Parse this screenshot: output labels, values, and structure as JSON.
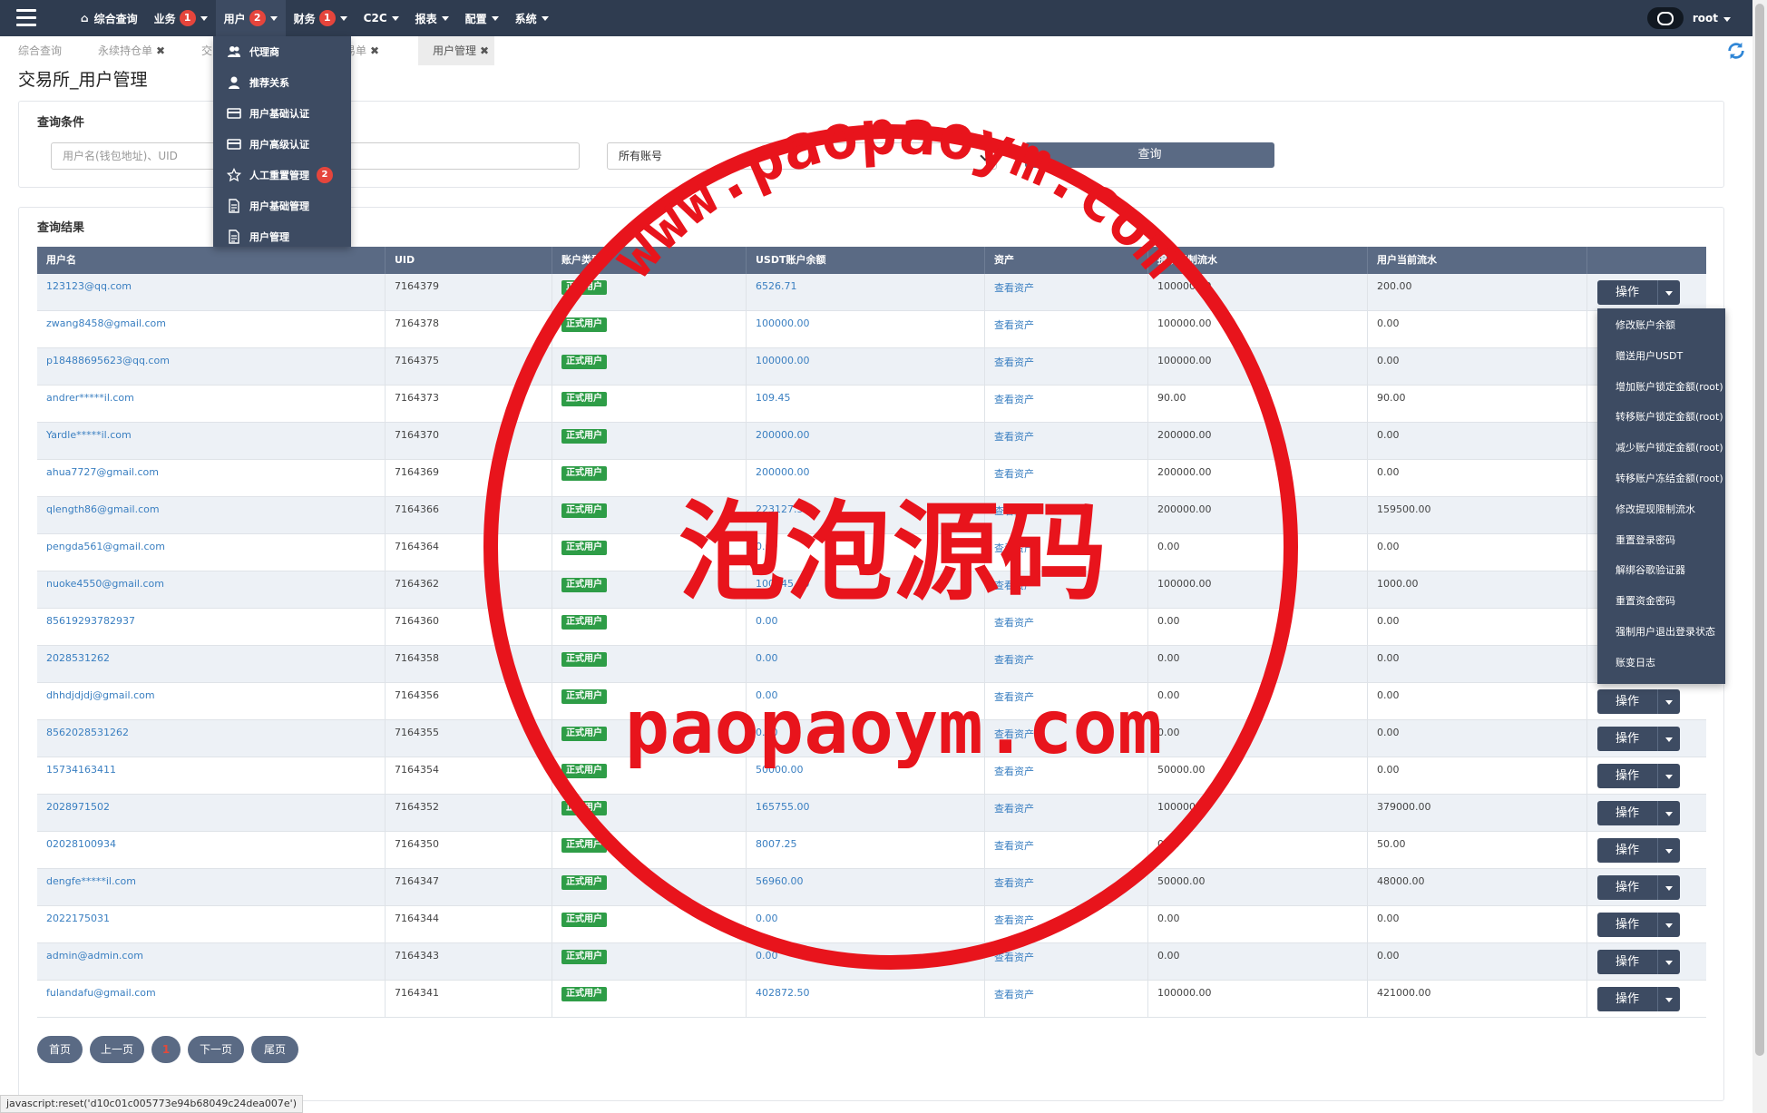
{
  "navbar": {
    "menu": [
      {
        "label": "综合查询",
        "badge": "",
        "caret": false,
        "home": true
      },
      {
        "label": "业务",
        "badge": "1",
        "caret": true
      },
      {
        "label": "用户",
        "badge": "2",
        "caret": true
      },
      {
        "label": "财务",
        "badge": "1",
        "caret": true
      },
      {
        "label": "C2C",
        "badge": "",
        "caret": true
      },
      {
        "label": "报表",
        "badge": "",
        "caret": true
      },
      {
        "label": "配置",
        "badge": "",
        "caret": true
      },
      {
        "label": "系统",
        "badge": "",
        "caret": true
      }
    ],
    "user": "root"
  },
  "tabs": [
    {
      "label": "综合查询",
      "closable": false
    },
    {
      "label": "永续持仓单",
      "closable": true
    },
    {
      "label": "交",
      "closable": false
    },
    {
      "label": "易单",
      "closable": true
    },
    {
      "label": "用户管理",
      "closable": true
    }
  ],
  "page_title": "交易所_用户管理",
  "query": {
    "title": "查询条件",
    "input_placeholder": "用户名(钱包地址)、UID",
    "account_select": "所有账号",
    "query_button": "查询"
  },
  "results": {
    "title": "查询结果",
    "columns": [
      "用户名",
      "UID",
      "账户类型",
      "USDT账户余额",
      "资产",
      "提现限制流水",
      "用户当前流水"
    ],
    "op_label": "操作",
    "rows": [
      {
        "user": "123123@qq.com",
        "uid": "7164379",
        "type": "正式用户",
        "usdt": "6526.71",
        "asset": "查看资产",
        "limit": "100000.00",
        "flow": "200.00"
      },
      {
        "user": "zwang8458@gmail.com",
        "uid": "7164378",
        "type": "正式用户",
        "usdt": "100000.00",
        "asset": "查看资产",
        "limit": "100000.00",
        "flow": "0.00"
      },
      {
        "user": "p18488695623@qq.com",
        "uid": "7164375",
        "type": "正式用户",
        "usdt": "100000.00",
        "asset": "查看资产",
        "limit": "100000.00",
        "flow": "0.00"
      },
      {
        "user": "andrer*****il.com",
        "uid": "7164373",
        "type": "正式用户",
        "usdt": "109.45",
        "asset": "查看资产",
        "limit": "90.00",
        "flow": "90.00"
      },
      {
        "user": "Yardle*****il.com",
        "uid": "7164370",
        "type": "正式用户",
        "usdt": "200000.00",
        "asset": "查看资产",
        "limit": "200000.00",
        "flow": "0.00"
      },
      {
        "user": "ahua7727@gmail.com",
        "uid": "7164369",
        "type": "正式用户",
        "usdt": "200000.00",
        "asset": "查看资产",
        "limit": "200000.00",
        "flow": "0.00"
      },
      {
        "user": "qlength86@gmail.com",
        "uid": "7164366",
        "type": "正式用户",
        "usdt": "223127.50",
        "asset": "查看资产",
        "limit": "200000.00",
        "flow": "159500.00"
      },
      {
        "user": "pengda561@gmail.com",
        "uid": "7164364",
        "type": "正式用户",
        "usdt": "0.00",
        "asset": "查看资产",
        "limit": "0.00",
        "flow": "0.00"
      },
      {
        "user": "nuoke4550@gmail.com",
        "uid": "7164362",
        "type": "正式用户",
        "usdt": "100145.00",
        "asset": "查看资产",
        "limit": "100000.00",
        "flow": "1000.00"
      },
      {
        "user": "85619293782937",
        "uid": "7164360",
        "type": "正式用户",
        "usdt": "0.00",
        "asset": "查看资产",
        "limit": "0.00",
        "flow": "0.00"
      },
      {
        "user": "2028531262",
        "uid": "7164358",
        "type": "正式用户",
        "usdt": "0.00",
        "asset": "查看资产",
        "limit": "0.00",
        "flow": "0.00"
      },
      {
        "user": "dhhdjdjdj@gmail.com",
        "uid": "7164356",
        "type": "正式用户",
        "usdt": "0.00",
        "asset": "查看资产",
        "limit": "0.00",
        "flow": "0.00"
      },
      {
        "user": "8562028531262",
        "uid": "7164355",
        "type": "正式用户",
        "usdt": "0.00",
        "asset": "查看资产",
        "limit": "0.00",
        "flow": "0.00"
      },
      {
        "user": "15734163411",
        "uid": "7164354",
        "type": "正式用户",
        "usdt": "50000.00",
        "asset": "查看资产",
        "limit": "50000.00",
        "flow": "0.00"
      },
      {
        "user": "2028971502",
        "uid": "7164352",
        "type": "正式用户",
        "usdt": "165755.00",
        "asset": "查看资产",
        "limit": "100000.00",
        "flow": "379000.00"
      },
      {
        "user": "02028100934",
        "uid": "7164350",
        "type": "正式用户",
        "usdt": "8007.25",
        "asset": "查看资产",
        "limit": "0.00",
        "flow": "50.00"
      },
      {
        "user": "dengfe*****il.com",
        "uid": "7164347",
        "type": "正式用户",
        "usdt": "56960.00",
        "asset": "查看资产",
        "limit": "50000.00",
        "flow": "48000.00"
      },
      {
        "user": "2022175031",
        "uid": "7164344",
        "type": "正式用户",
        "usdt": "0.00",
        "asset": "查看资产",
        "limit": "0.00",
        "flow": "0.00"
      },
      {
        "user": "admin@admin.com",
        "uid": "7164343",
        "type": "正式用户",
        "usdt": "0.00",
        "asset": "查看资产",
        "limit": "0.00",
        "flow": "0.00"
      },
      {
        "user": "fulandafu@gmail.com",
        "uid": "7164341",
        "type": "正式用户",
        "usdt": "402872.50",
        "asset": "查看资产",
        "limit": "100000.00",
        "flow": "421000.00"
      }
    ]
  },
  "user_menu": [
    {
      "label": "代理商",
      "icon": "users-icon",
      "badge": ""
    },
    {
      "label": "推荐关系",
      "icon": "user-icon",
      "badge": ""
    },
    {
      "label": "用户基础认证",
      "icon": "id-card-icon",
      "badge": ""
    },
    {
      "label": "用户高级认证",
      "icon": "id-card-icon",
      "badge": ""
    },
    {
      "label": "人工重置管理",
      "icon": "star-icon",
      "badge": "2"
    },
    {
      "label": "用户基础管理",
      "icon": "document-icon",
      "badge": ""
    },
    {
      "label": "用户管理",
      "icon": "document-icon",
      "badge": ""
    }
  ],
  "op_menu": [
    "修改账户余额",
    "赠送用户USDT",
    "增加账户锁定金额(root)",
    "转移账户锁定金额(root)",
    "减少账户锁定金额(root)",
    "转移账户冻结金额(root)",
    "修改提现限制流水",
    "重置登录密码",
    "解绑谷歌验证器",
    "重置资金密码",
    "强制用户退出登录状态",
    "账变日志"
  ],
  "pagination": [
    "首页",
    "上一页",
    "1",
    "下一页",
    "尾页"
  ],
  "status_bar": "javascript:reset('d10c01c005773e94b68049c24dea007e')",
  "watermark": {
    "arc_text": "www.paopaoym.com",
    "center_text": "泡泡源码",
    "bottom_text": "paopaoym.com",
    "color": "#e8141c"
  },
  "colors": {
    "navbar": "#2f3c50",
    "menu": "#3d4b62",
    "header": "#5a6a84",
    "link": "#3a7fc1",
    "badge": "#e5453c",
    "tag": "#2e9d47"
  }
}
